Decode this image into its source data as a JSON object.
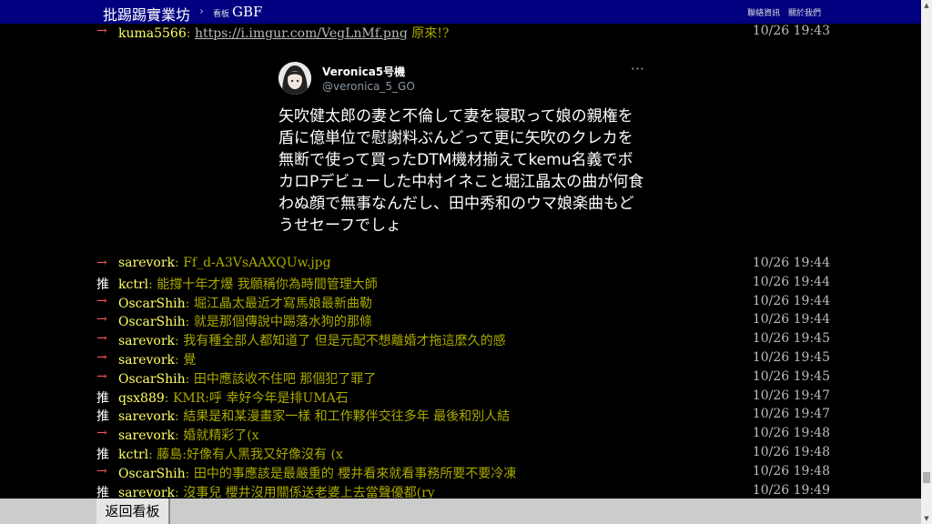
{
  "header": {
    "logo": "批踢踢實業坊",
    "separator": "›",
    "board_label": "看板",
    "board_name": "GBF",
    "links": [
      "聯絡資訊",
      "關於我們"
    ]
  },
  "top_push": {
    "tag": "→",
    "user": "kuma5566",
    "url": "https://i.imgur.com/VegLnMf.png",
    "text": " 原來!?",
    "time": "10/26 19:43"
  },
  "tweet": {
    "name": "Veronica5号機",
    "handle": "@veronica_5_GO",
    "more": "···",
    "body": "矢吹健太郎の妻と不倫して妻を寝取って娘の親権を盾に億単位で慰謝料ぶんどって更に矢吹のクレカを無断で使って買ったDTM機材揃えてkemu名義でボカロPデビューした中村イネこと堀江晶太の曲が何食わぬ顔で無事なんだし、田中秀和のウマ娘楽曲もどうせセーフでしょ"
  },
  "pushes": [
    {
      "tag": "→",
      "user": "sarevork",
      "text": "Ff_d-A3VsAAXQUw.jpg",
      "time": "10/26 19:44"
    },
    {
      "tag": "推",
      "user": "kctrl",
      "text": "能撐十年才爆 我願稱你為時間管理大師",
      "time": "10/26 19:44"
    },
    {
      "tag": "→",
      "user": "OscarShih",
      "text": "堀江晶太最近才寫馬娘最新曲勒",
      "time": "10/26 19:44"
    },
    {
      "tag": "→",
      "user": "OscarShih",
      "text": "就是那個傳說中踢落水狗的那條",
      "time": "10/26 19:44"
    },
    {
      "tag": "→",
      "user": "sarevork",
      "text": "我有種全部人都知道了 但是元配不想離婚才拖這麼久的感",
      "time": "10/26 19:45"
    },
    {
      "tag": "→",
      "user": "sarevork",
      "text": "覺",
      "time": "10/26 19:45"
    },
    {
      "tag": "→",
      "user": "OscarShih",
      "text": "田中應該收不住吧 那個犯了罪了",
      "time": "10/26 19:45"
    },
    {
      "tag": "推",
      "user": "qsx889",
      "text": "KMR:呼 幸好今年是排UMA石",
      "time": "10/26 19:47"
    },
    {
      "tag": "推",
      "user": "sarevork",
      "text": "結果是和某漫畫家一樣 和工作夥伴交往多年 最後和別人結",
      "time": "10/26 19:47"
    },
    {
      "tag": "→",
      "user": "sarevork",
      "text": "婚就精彩了(x",
      "time": "10/26 19:48"
    },
    {
      "tag": "推",
      "user": "kctrl",
      "text": "藤島:好像有人黑我又好像沒有 (x",
      "time": "10/26 19:48"
    },
    {
      "tag": "→",
      "user": "OscarShih",
      "text": "田中的事應該是最嚴重的 櫻井看來就看事務所要不要冷凍",
      "time": "10/26 19:48"
    },
    {
      "tag": "推",
      "user": "sarevork",
      "text": "沒事兒 櫻井沒用關係送老婆上去當聲優都(ry",
      "time": "10/26 19:49"
    }
  ],
  "footer": {
    "back_label": "返回看板"
  },
  "scrollbar": {
    "up": "▲",
    "down": "▼"
  }
}
